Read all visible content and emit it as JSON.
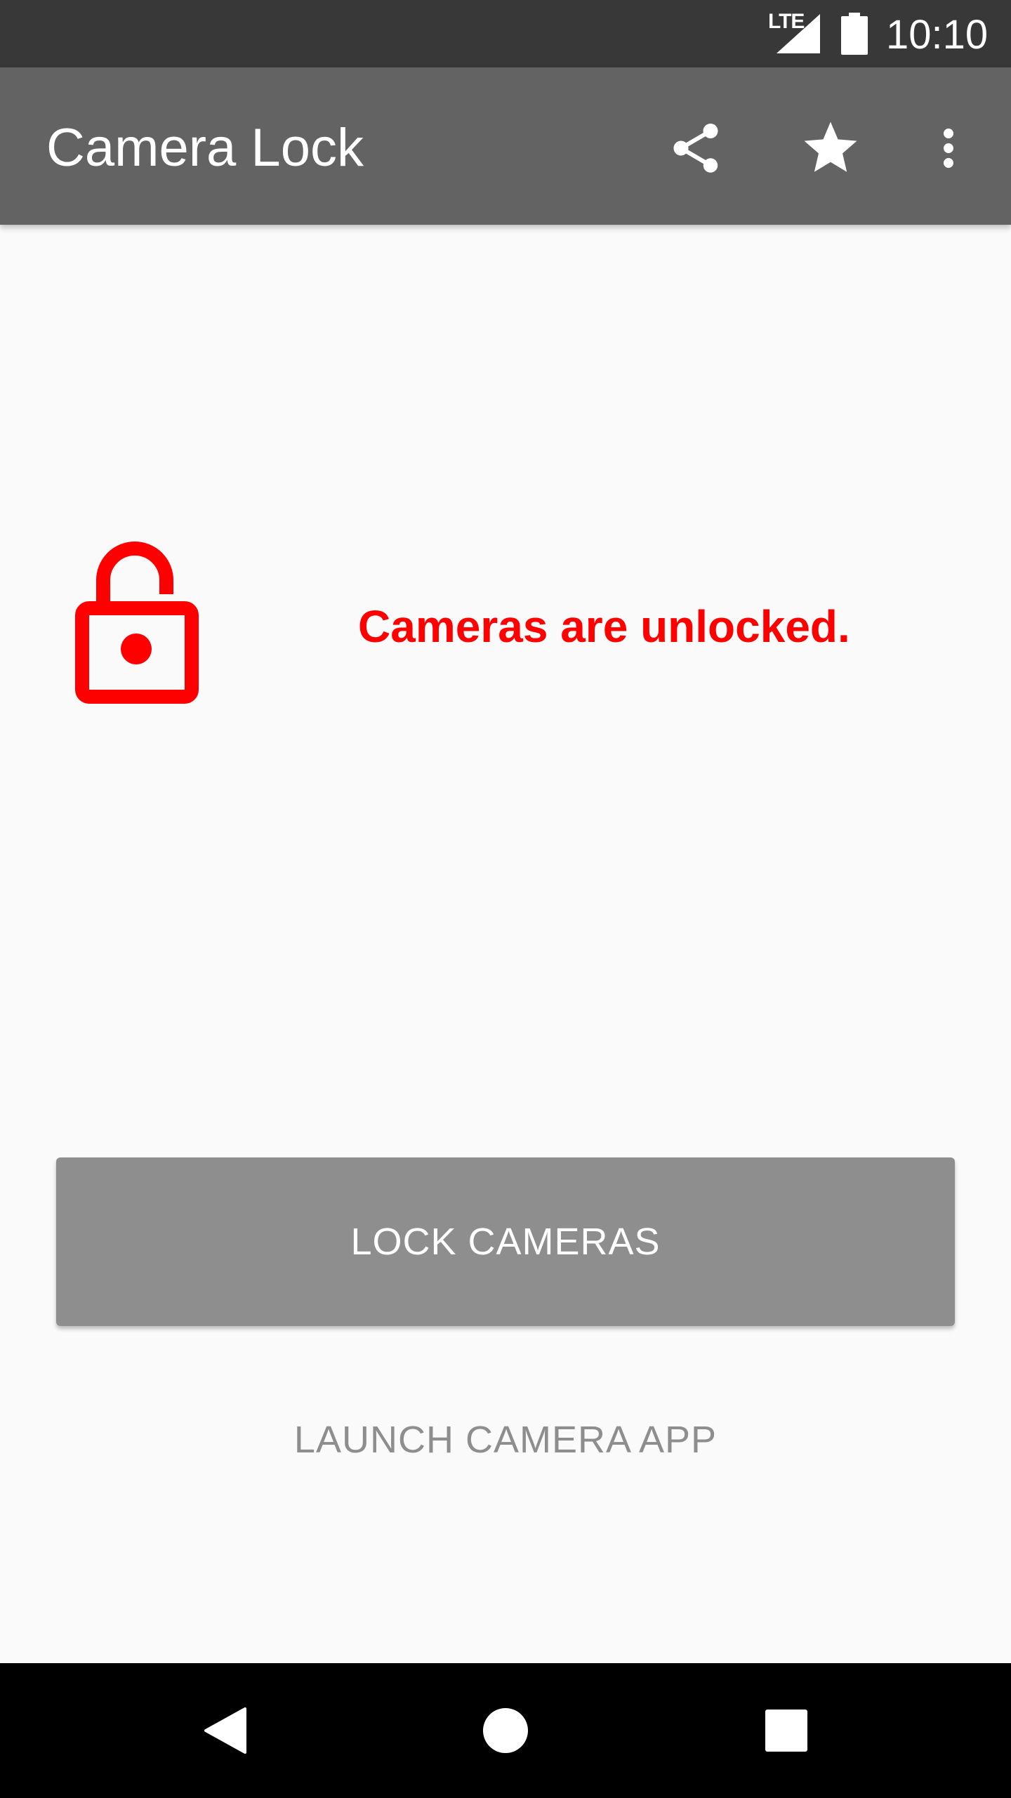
{
  "status_bar": {
    "network": "LTE",
    "time": "10:10"
  },
  "app_bar": {
    "title": "Camera Lock",
    "actions": [
      "share-icon",
      "star-icon",
      "more-vert-icon"
    ]
  },
  "main": {
    "lock_state_icon": "lock-open-icon",
    "status_text": "Cameras are unlocked.",
    "status_color": "#ff0000",
    "lock_button_label": "LOCK CAMERAS",
    "launch_button_label": "LAUNCH CAMERA APP"
  },
  "nav_bar": {
    "buttons": [
      "back-icon",
      "home-icon",
      "recents-icon"
    ]
  },
  "colors": {
    "status_bar": "#383838",
    "app_bar": "#636363",
    "background": "#fafafa",
    "button": "#8e8e8e",
    "nav_bar": "#000000"
  }
}
